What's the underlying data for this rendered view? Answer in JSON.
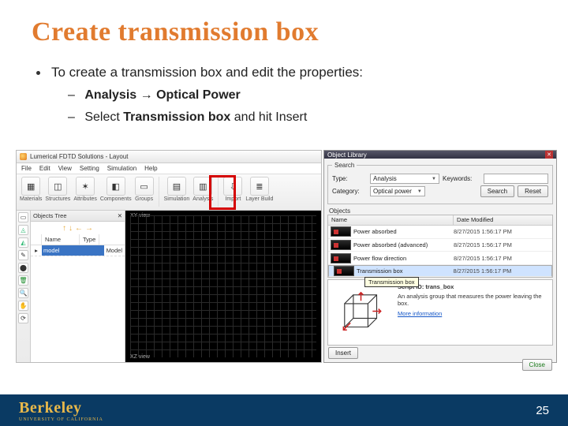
{
  "title": "Create transmission box",
  "bullets": {
    "b1": "To create a transmission box and edit the properties:",
    "b2a_prefix": "Analysis",
    "b2a_arrow": "→",
    "b2a_suffix": "Optical Power",
    "b2b_prefix": "Select ",
    "b2b_bold": "Transmission box",
    "b2b_suffix": " and hit Insert"
  },
  "app": {
    "title": "Lumerical FDTD Solutions - Layout",
    "menus": [
      "File",
      "Edit",
      "View",
      "Setting",
      "Simulation",
      "Help"
    ],
    "toolbar": [
      {
        "label": "Materials",
        "glyph": "▦"
      },
      {
        "label": "Structures",
        "glyph": "◫"
      },
      {
        "label": "Attributes",
        "glyph": "✶"
      },
      {
        "label": "Components",
        "glyph": "◧"
      },
      {
        "label": "Groups",
        "glyph": "▭"
      },
      {
        "label": "Simulation",
        "glyph": "▤"
      },
      {
        "label": "Analysis",
        "glyph": "▥"
      },
      {
        "label": "Import",
        "glyph": "⇩"
      },
      {
        "label": "Layer Build",
        "glyph": "≣"
      }
    ],
    "tree_header": "Objects Tree",
    "tree_pin": "✕",
    "col_name": "Name",
    "col_type": "Type",
    "row_name": "model",
    "row_type": "Model",
    "view_top": "XY view",
    "view_bottom": "XZ view"
  },
  "lib": {
    "title": "Object Library",
    "search_legend": "Search",
    "type_label": "Type:",
    "type_value": "Analysis",
    "kw_label": "Keywords:",
    "cat_label": "Category:",
    "cat_value": "Optical power",
    "search_btn": "Search",
    "reset_btn": "Reset",
    "objects_legend": "Objects",
    "col_name": "Name",
    "col_date": "Date Modified",
    "rows": [
      {
        "name": "Power absorbed",
        "date": "8/27/2015 1:56:17 PM"
      },
      {
        "name": "Power absorbed (advanced)",
        "date": "8/27/2015 1:56:17 PM"
      },
      {
        "name": "Power flow direction",
        "date": "8/27/2015 1:56:17 PM"
      },
      {
        "name": "Transmission box",
        "date": "8/27/2015 1:56:17 PM"
      }
    ],
    "tooltip": "Transmission box",
    "script_label": "Script ID: trans_box",
    "desc": "An analysis group that measures the power leaving the box.",
    "more": "More information",
    "insert": "Insert",
    "close": "Close"
  },
  "footer": {
    "logo": "Berkeley",
    "sub": "UNIVERSITY OF CALIFORNIA",
    "page": "25"
  }
}
